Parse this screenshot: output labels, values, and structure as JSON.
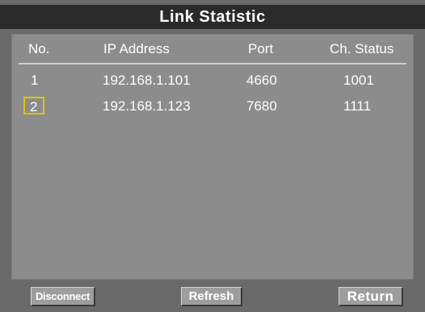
{
  "window": {
    "title": "Link Statistic"
  },
  "table": {
    "columns": [
      "No.",
      "IP Address",
      "Port",
      "Ch. Status"
    ],
    "rows": [
      {
        "no": "1",
        "ip": "192.168.1.101",
        "port": "4660",
        "status": "1001",
        "selected": false
      },
      {
        "no": "2",
        "ip": "192.168.1.123",
        "port": "7680",
        "status": "1111",
        "selected": true
      }
    ]
  },
  "buttons": {
    "disconnect": "Disconnect",
    "refresh": "Refresh",
    "return": "Return"
  },
  "colors": {
    "background": "#6a6a6a",
    "panel": "#8c8c8c",
    "title_bar": "#2a2a2a",
    "selection_border": "#e0c400",
    "text": "#ffffff"
  }
}
